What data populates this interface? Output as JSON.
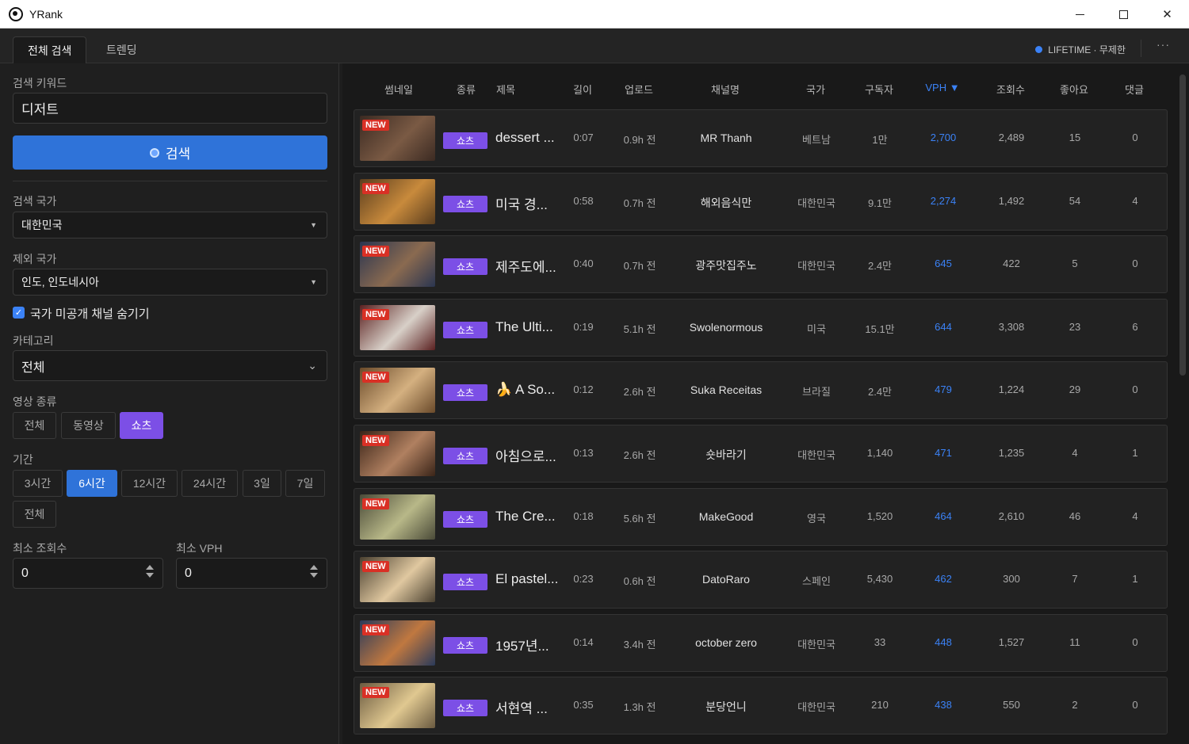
{
  "window": {
    "title": "YRank"
  },
  "tabs": [
    {
      "label": "전체 검색"
    },
    {
      "label": "트렌딩"
    }
  ],
  "license": {
    "text": "LIFETIME · 무제한",
    "dot_color": "#3b82f6"
  },
  "sidebar": {
    "keyword_label": "검색 키워드",
    "keyword_value": "디저트",
    "search_button": "검색",
    "country_label": "검색 국가",
    "country_value": "대한민국",
    "exclude_label": "제외 국가",
    "exclude_value": "인도, 인도네시아",
    "hide_private_label": "국가 미공개 채널 숨기기",
    "category_label": "카테고리",
    "category_value": "전체",
    "video_type_label": "영상 종류",
    "video_types": [
      "전체",
      "동영상",
      "쇼츠"
    ],
    "period_label": "기간",
    "periods": [
      "3시간",
      "6시간",
      "12시간",
      "24시간",
      "3일",
      "7일",
      "전체"
    ],
    "min_views_label": "최소 조회수",
    "min_views_value": "0",
    "min_vph_label": "최소 VPH",
    "min_vph_value": "0"
  },
  "table": {
    "headers": [
      "썸네일",
      "종류",
      "제목",
      "길이",
      "업로드",
      "채널명",
      "국가",
      "구독자",
      "VPH ▼",
      "조회수",
      "좋아요",
      "댓글"
    ],
    "new_badge": "NEW",
    "rows": [
      {
        "type": "쇼츠",
        "title": "dessert ...",
        "length": "0:07",
        "upload": "0.9h 전",
        "channel": "MR Thanh",
        "country": "베트남",
        "subs": "1만",
        "vph": "2,700",
        "views": "2,489",
        "likes": "15",
        "comments": "0"
      },
      {
        "type": "쇼츠",
        "title": "미국 경...",
        "length": "0:58",
        "upload": "0.7h 전",
        "channel": "해외음식만",
        "country": "대한민국",
        "subs": "9.1만",
        "vph": "2,274",
        "views": "1,492",
        "likes": "54",
        "comments": "4"
      },
      {
        "type": "쇼츠",
        "title": "제주도에...",
        "length": "0:40",
        "upload": "0.7h 전",
        "channel": "광주맛집주노",
        "country": "대한민국",
        "subs": "2.4만",
        "vph": "645",
        "views": "422",
        "likes": "5",
        "comments": "0"
      },
      {
        "type": "쇼츠",
        "title": "The Ulti...",
        "length": "0:19",
        "upload": "5.1h 전",
        "channel": "Swolenormous",
        "country": "미국",
        "subs": "15.1만",
        "vph": "644",
        "views": "3,308",
        "likes": "23",
        "comments": "6"
      },
      {
        "type": "쇼츠",
        "title": "🍌 A So...",
        "length": "0:12",
        "upload": "2.6h 전",
        "channel": "Suka Receitas",
        "country": "브라질",
        "subs": "2.4만",
        "vph": "479",
        "views": "1,224",
        "likes": "29",
        "comments": "0"
      },
      {
        "type": "쇼츠",
        "title": "아침으로...",
        "length": "0:13",
        "upload": "2.6h 전",
        "channel": "숏바라기",
        "country": "대한민국",
        "subs": "1,140",
        "vph": "471",
        "views": "1,235",
        "likes": "4",
        "comments": "1"
      },
      {
        "type": "쇼츠",
        "title": "The Cre...",
        "length": "0:18",
        "upload": "5.6h 전",
        "channel": "MakeGood",
        "country": "영국",
        "subs": "1,520",
        "vph": "464",
        "views": "2,610",
        "likes": "46",
        "comments": "4"
      },
      {
        "type": "쇼츠",
        "title": "El pastel...",
        "length": "0:23",
        "upload": "0.6h 전",
        "channel": "DatoRaro",
        "country": "스페인",
        "subs": "5,430",
        "vph": "462",
        "views": "300",
        "likes": "7",
        "comments": "1"
      },
      {
        "type": "쇼츠",
        "title": "1957년...",
        "length": "0:14",
        "upload": "3.4h 전",
        "channel": "october zero",
        "country": "대한민국",
        "subs": "33",
        "vph": "448",
        "views": "1,527",
        "likes": "11",
        "comments": "0"
      },
      {
        "type": "쇼츠",
        "title": "서현역 ...",
        "length": "0:35",
        "upload": "1.3h 전",
        "channel": "분당언니",
        "country": "대한민국",
        "subs": "210",
        "vph": "438",
        "views": "550",
        "likes": "2",
        "comments": "0"
      }
    ]
  }
}
